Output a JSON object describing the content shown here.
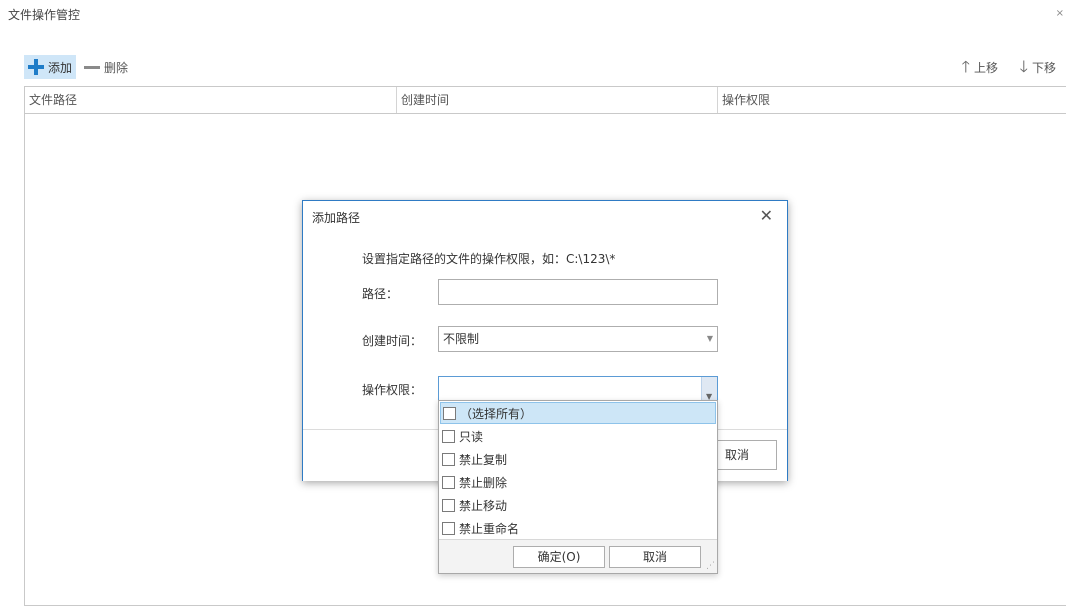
{
  "window": {
    "title": "文件操作管控",
    "close_glyph": "×"
  },
  "toolbar": {
    "add_label": "添加",
    "delete_label": "删除",
    "up_label": "上移",
    "down_label": "下移"
  },
  "grid": {
    "columns": [
      "文件路径",
      "创建时间",
      "操作权限"
    ]
  },
  "dialog": {
    "title": "添加路径",
    "close_glyph": "✕",
    "description": "设置指定路径的文件的操作权限，如：C:\\123\\*",
    "path_label": "路径：",
    "path_value": "",
    "time_label": "创建时间：",
    "time_value": "不限制",
    "perm_label": "操作权限：",
    "perm_value": "",
    "cancel_label": "取消"
  },
  "perm_dropdown": {
    "items": [
      {
        "label": "（选择所有）",
        "checked": false,
        "highlighted": true
      },
      {
        "label": "只读",
        "checked": false
      },
      {
        "label": "禁止复制",
        "checked": false
      },
      {
        "label": "禁止删除",
        "checked": false
      },
      {
        "label": "禁止移动",
        "checked": false
      },
      {
        "label": "禁止重命名",
        "checked": false
      }
    ],
    "ok_label": "确定(O)",
    "cancel_label": "取消"
  },
  "colors": {
    "accent": "#1e7cc8",
    "dialog_border": "#2f7bc4",
    "selected_bg": "#cde6f7"
  }
}
